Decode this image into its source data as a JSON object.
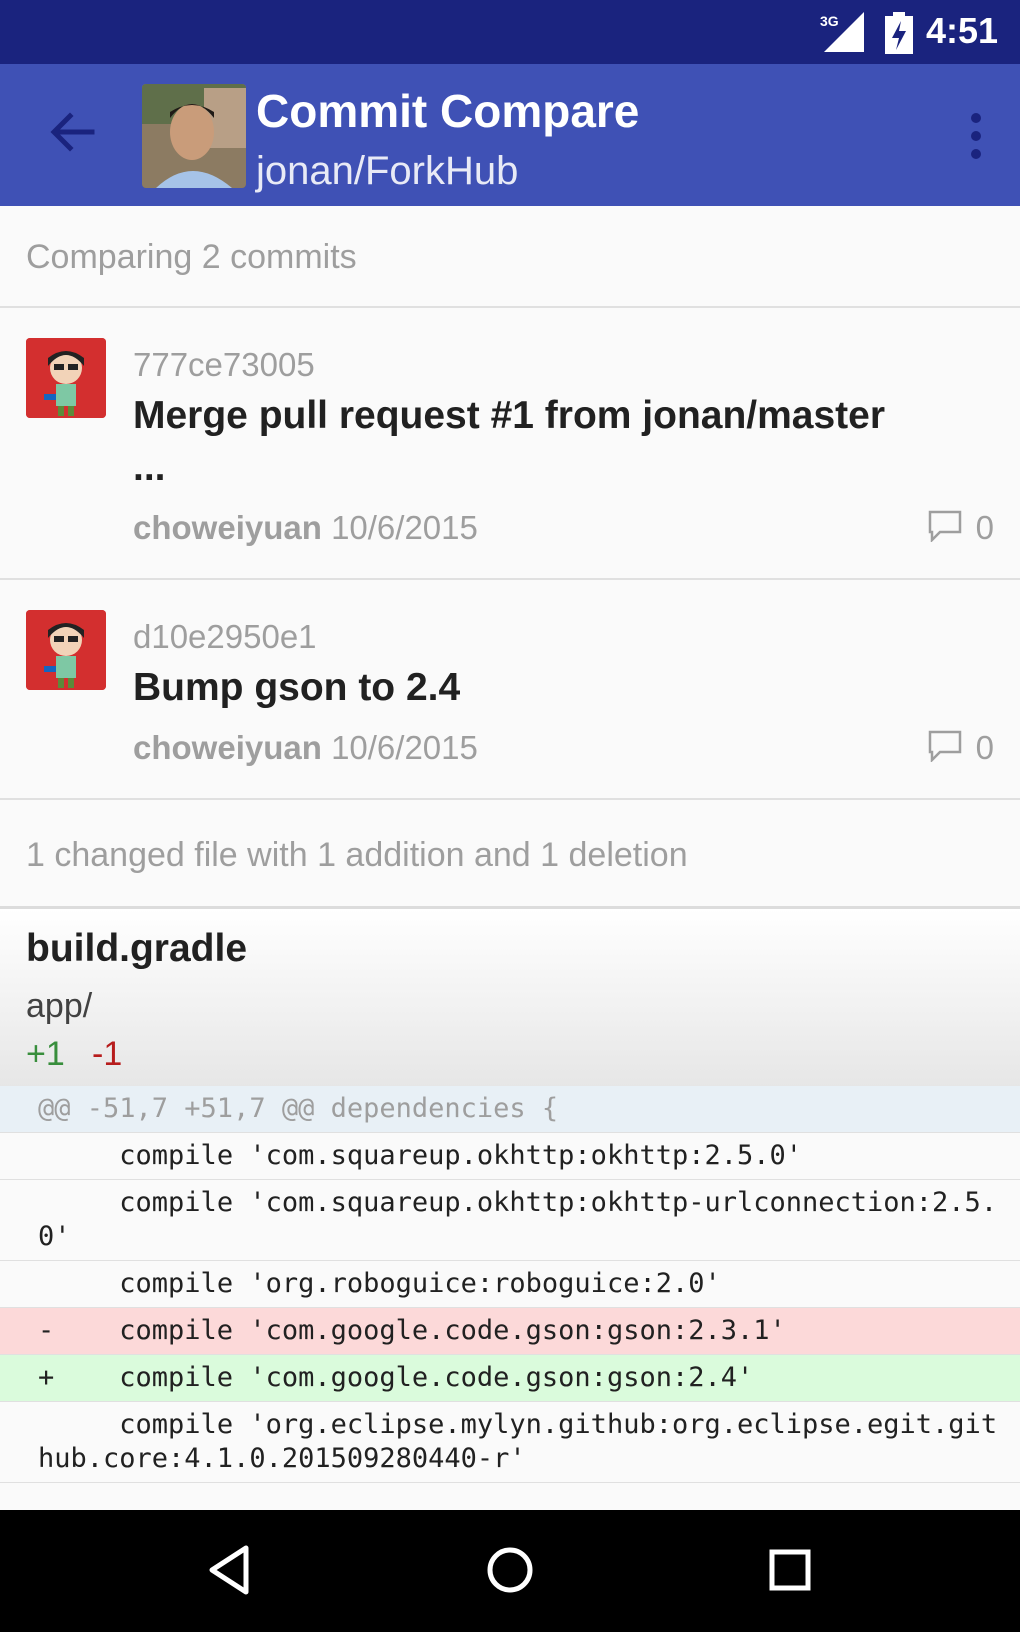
{
  "status": {
    "network": "3G",
    "time": "4:51"
  },
  "appbar": {
    "title": "Commit Compare",
    "subtitle": "jonan/ForkHub"
  },
  "summary": "Comparing 2 commits",
  "commits": [
    {
      "sha": "777ce73005",
      "message": "Merge pull request #1 from jonan/master\n...",
      "author": "choweiyuan",
      "date": "10/6/2015",
      "comments": "0"
    },
    {
      "sha": "d10e2950e1",
      "message": "Bump gson to 2.4",
      "author": "choweiyuan",
      "date": "10/6/2015",
      "comments": "0"
    }
  ],
  "files_summary": "1 changed file with 1 addition  and 1 deletion",
  "file": {
    "name": "build.gradle",
    "dir": "app/",
    "additions": "+1",
    "deletions": "-1"
  },
  "diff": [
    {
      "type": "hunk",
      "text": "@@ -51,7 +51,7 @@ dependencies {"
    },
    {
      "type": "ctx",
      "text": "     compile 'com.squareup.okhttp:okhttp:2.5.0'"
    },
    {
      "type": "ctx",
      "text": "     compile 'com.squareup.okhttp:okhttp-urlconnection:2.5.0'"
    },
    {
      "type": "ctx",
      "text": "     compile 'org.roboguice:roboguice:2.0'"
    },
    {
      "type": "rem",
      "text": "-    compile 'com.google.code.gson:gson:2.3.1'"
    },
    {
      "type": "addl",
      "text": "+    compile 'com.google.code.gson:gson:2.4'"
    },
    {
      "type": "ctx",
      "text": "     compile 'org.eclipse.mylyn.github:org.eclipse.egit.github.core:4.1.0.201509280440-r'"
    }
  ]
}
